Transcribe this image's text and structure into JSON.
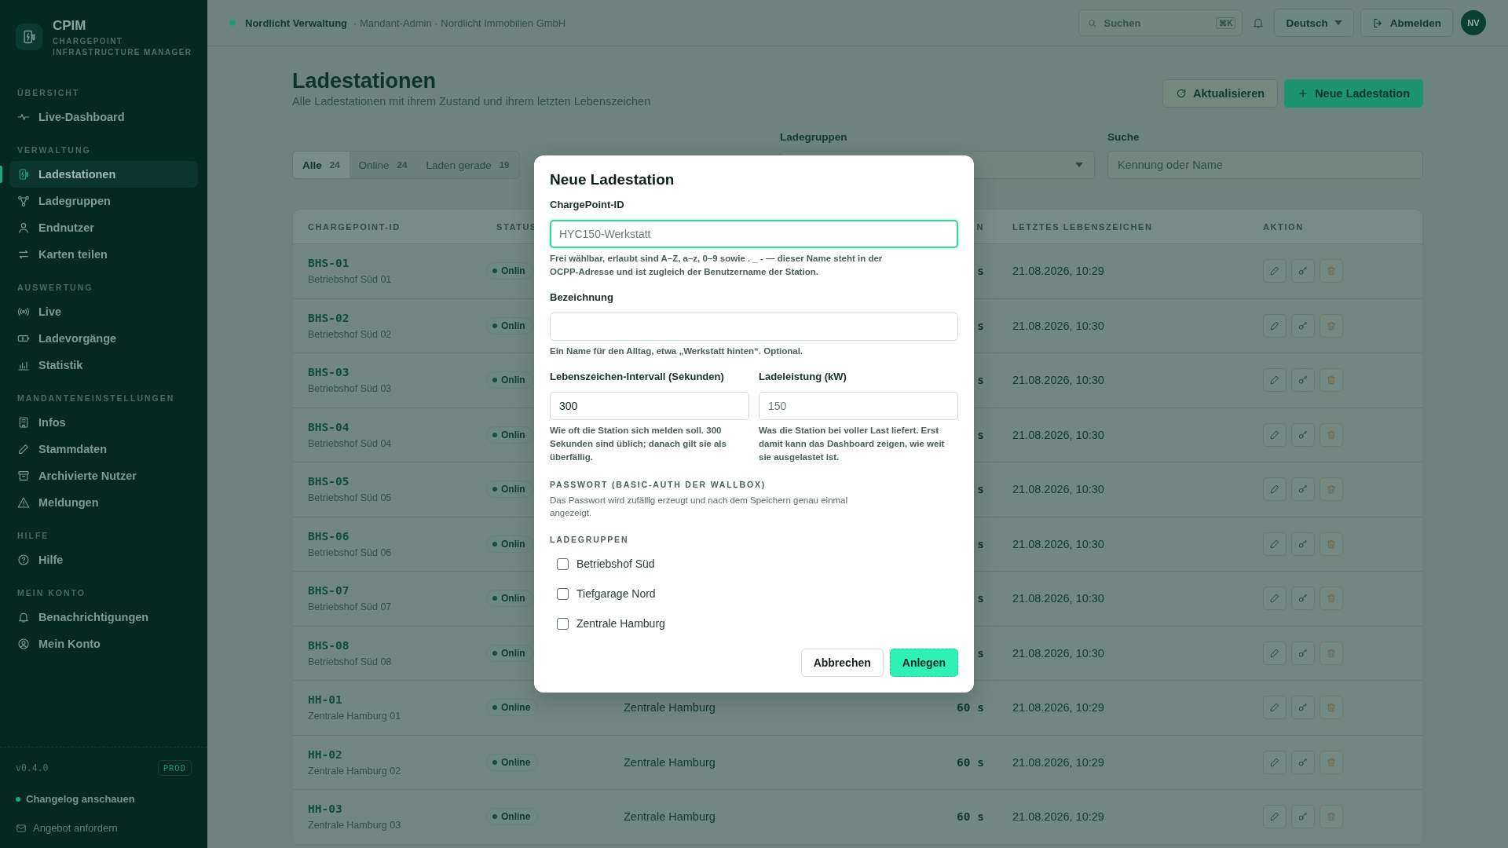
{
  "sidebar": {
    "brand": {
      "title": "CPIM",
      "subtitle": "CHARGEPOINT INFRASTRUCTURE MANAGER"
    },
    "sections": [
      {
        "heading": "ÜBERSICHT",
        "items": [
          {
            "label": "Live-Dashboard",
            "kind": "pulse",
            "selected": false
          }
        ]
      },
      {
        "heading": "VERWALTUNG",
        "items": [
          {
            "label": "Ladestationen",
            "kind": "charger",
            "selected": true
          },
          {
            "label": "Ladegruppen",
            "kind": "nodes",
            "selected": false
          },
          {
            "label": "Endnutzer",
            "kind": "user",
            "selected": false
          },
          {
            "label": "Karten teilen",
            "kind": "swap",
            "selected": false
          }
        ]
      },
      {
        "heading": "AUSWERTUNG",
        "items": [
          {
            "label": "Live",
            "kind": "broadcast",
            "selected": false
          },
          {
            "label": "Ladevorgänge",
            "kind": "battery",
            "selected": false
          },
          {
            "label": "Statistik",
            "kind": "chart",
            "selected": false
          }
        ]
      },
      {
        "heading": "MANDANTENEINSTELLUNGEN",
        "items": [
          {
            "label": "Infos",
            "kind": "building",
            "selected": false
          },
          {
            "label": "Stammdaten",
            "kind": "pencil",
            "selected": false
          },
          {
            "label": "Archivierte Nutzer",
            "kind": "archive",
            "selected": false
          },
          {
            "label": "Meldungen",
            "kind": "warning",
            "selected": false
          }
        ]
      },
      {
        "heading": "HILFE",
        "items": [
          {
            "label": "Hilfe",
            "kind": "help",
            "selected": false
          }
        ]
      },
      {
        "heading": "MEIN KONTO",
        "items": [
          {
            "label": "Benachrichtigungen",
            "kind": "bell",
            "selected": false
          },
          {
            "label": "Mein Konto",
            "kind": "account",
            "selected": false
          }
        ]
      }
    ],
    "footer": {
      "version": "v0.4.0",
      "environment": "PROD",
      "changelog": "Changelog anschauen",
      "offer": "Angebot anfordern"
    }
  },
  "topbar": {
    "tenant": "Nordlicht Verwaltung",
    "context": "· Mandant-Admin · Nordlicht Immobilien GmbH",
    "search": {
      "placeholder": "Suchen",
      "shortcut": "⌘K"
    },
    "language": "Deutsch",
    "logout": "Abmelden",
    "avatar": "NV"
  },
  "page": {
    "title": "Ladestationen",
    "subtitle": "Alle Ladestationen mit ihrem Zustand und ihrem letzten Lebenszeichen",
    "buttons": [
      {
        "label": "Aktualisieren",
        "kind": "refresh"
      },
      {
        "label": "Neue Ladestation",
        "kind": "add"
      }
    ]
  },
  "filters": {
    "tabs": [
      {
        "label": "Alle",
        "count": "24",
        "selected": true
      },
      {
        "label": "Online",
        "count": "24",
        "selected": false
      },
      {
        "label": "Laden gerade",
        "count": "19",
        "selected": false
      }
    ],
    "group_select": {
      "label": "Ladegruppen"
    },
    "search": {
      "label": "Suche",
      "placeholder": "Kennung oder Name"
    }
  },
  "table": {
    "columns": [
      "CHARGEPOINT-ID",
      "STATUS",
      "",
      "N",
      "LETZTES LEBENSZEICHEN",
      "AKTION"
    ],
    "rows": [
      {
        "id": "BHS-01",
        "name": "Betriebshof Süd 01",
        "status": "Onlin",
        "interval": "s",
        "last_seen": "21.08.2026, 10:29"
      },
      {
        "id": "BHS-02",
        "name": "Betriebshof Süd 02",
        "status": "Onlin",
        "interval": "s",
        "last_seen": "21.08.2026, 10:30"
      },
      {
        "id": "BHS-03",
        "name": "Betriebshof Süd 03",
        "status": "Onlin",
        "interval": "s",
        "last_seen": "21.08.2026, 10:30"
      },
      {
        "id": "BHS-04",
        "name": "Betriebshof Süd 04",
        "status": "Onlin",
        "interval": "s",
        "last_seen": "21.08.2026, 10:30"
      },
      {
        "id": "BHS-05",
        "name": "Betriebshof Süd 05",
        "status": "Onlin",
        "interval": "s",
        "last_seen": "21.08.2026, 10:30"
      },
      {
        "id": "BHS-06",
        "name": "Betriebshof Süd 06",
        "status": "Onlin",
        "interval": "s",
        "last_seen": "21.08.2026, 10:30"
      },
      {
        "id": "BHS-07",
        "name": "Betriebshof Süd 07",
        "status": "Onlin",
        "interval": "s",
        "last_seen": "21.08.2026, 10:30"
      },
      {
        "id": "BHS-08",
        "name": "Betriebshof Süd 08",
        "status": "Onlin",
        "interval": "s",
        "last_seen": "21.08.2026, 10:30"
      },
      {
        "id": "HH-01",
        "name": "Zentrale Hamburg 01",
        "status": "Online",
        "group": "Zentrale Hamburg",
        "interval": "60 s",
        "last_seen": "21.08.2026, 10:29"
      },
      {
        "id": "HH-02",
        "name": "Zentrale Hamburg 02",
        "status": "Online",
        "group": "Zentrale Hamburg",
        "interval": "60 s",
        "last_seen": "21.08.2026, 10:29"
      },
      {
        "id": "HH-03",
        "name": "Zentrale Hamburg 03",
        "status": "Online",
        "group": "Zentrale Hamburg",
        "interval": "60 s",
        "last_seen": "21.08.2026, 10:29"
      }
    ]
  },
  "dialog": {
    "title": "Neue Ladestation",
    "id_field": {
      "label": "ChargePoint-ID",
      "placeholder": "HYC150-Werkstatt",
      "focused": true,
      "hint": "Frei wählbar, erlaubt sind A–Z, a–z, 0–9 sowie . _ - — dieser Name steht in der OCPP-Adresse und ist zugleich der Benutzername der Station."
    },
    "name_field": {
      "label": "Bezeichnung",
      "focused": false,
      "hint": "Ein Name für den Alltag, etwa „Werkstatt hinten“. Optional."
    },
    "interval_field": {
      "label": "Lebenszeichen-Intervall (Sekunden)",
      "value": "300",
      "focused": false,
      "hint": "Wie oft die Station sich melden soll. 300 Sekunden sind üblich; danach gilt sie als überfällig."
    },
    "power_field": {
      "label": "Ladeleistung (kW)",
      "placeholder": "150",
      "focused": false,
      "hint": "Was die Station bei voller Last liefert. Erst damit kann das Dashboard zeigen, wie weit sie ausgelastet ist."
    },
    "password": {
      "heading": "PASSWORT (BASIC-AUTH DER WALLBOX)",
      "text": "Das Passwort wird zufällig erzeugt und nach dem Speichern genau einmal angezeigt."
    },
    "groups_heading": "LADEGRUPPEN",
    "groups": [
      {
        "label": "Betriebshof Süd",
        "checked": false
      },
      {
        "label": "Tiefgarage Nord",
        "checked": false
      },
      {
        "label": "Zentrale Hamburg",
        "checked": false
      }
    ],
    "buttons": [
      {
        "label": "Abbrechen",
        "kind": "secondary"
      },
      {
        "label": "Anlegen",
        "kind": "primary"
      }
    ]
  }
}
